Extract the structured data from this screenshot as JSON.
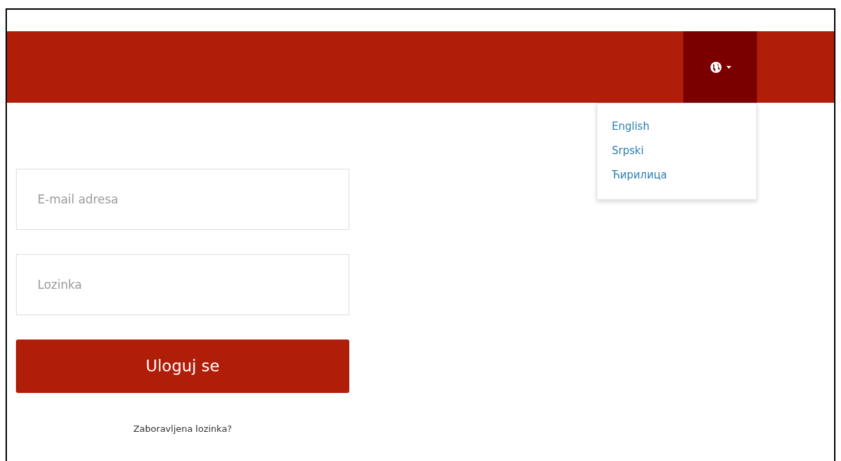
{
  "navbar": {
    "language_menu": {
      "expanded": true,
      "items": [
        {
          "label": "English"
        },
        {
          "label": "Srpski"
        },
        {
          "label": "Ћирилица"
        }
      ]
    }
  },
  "login_form": {
    "email": {
      "placeholder": "E-mail adresa"
    },
    "password": {
      "placeholder": "Lozinka"
    },
    "submit": "Uloguj se",
    "forgot_link": "Zaboravljena lozinka?"
  }
}
